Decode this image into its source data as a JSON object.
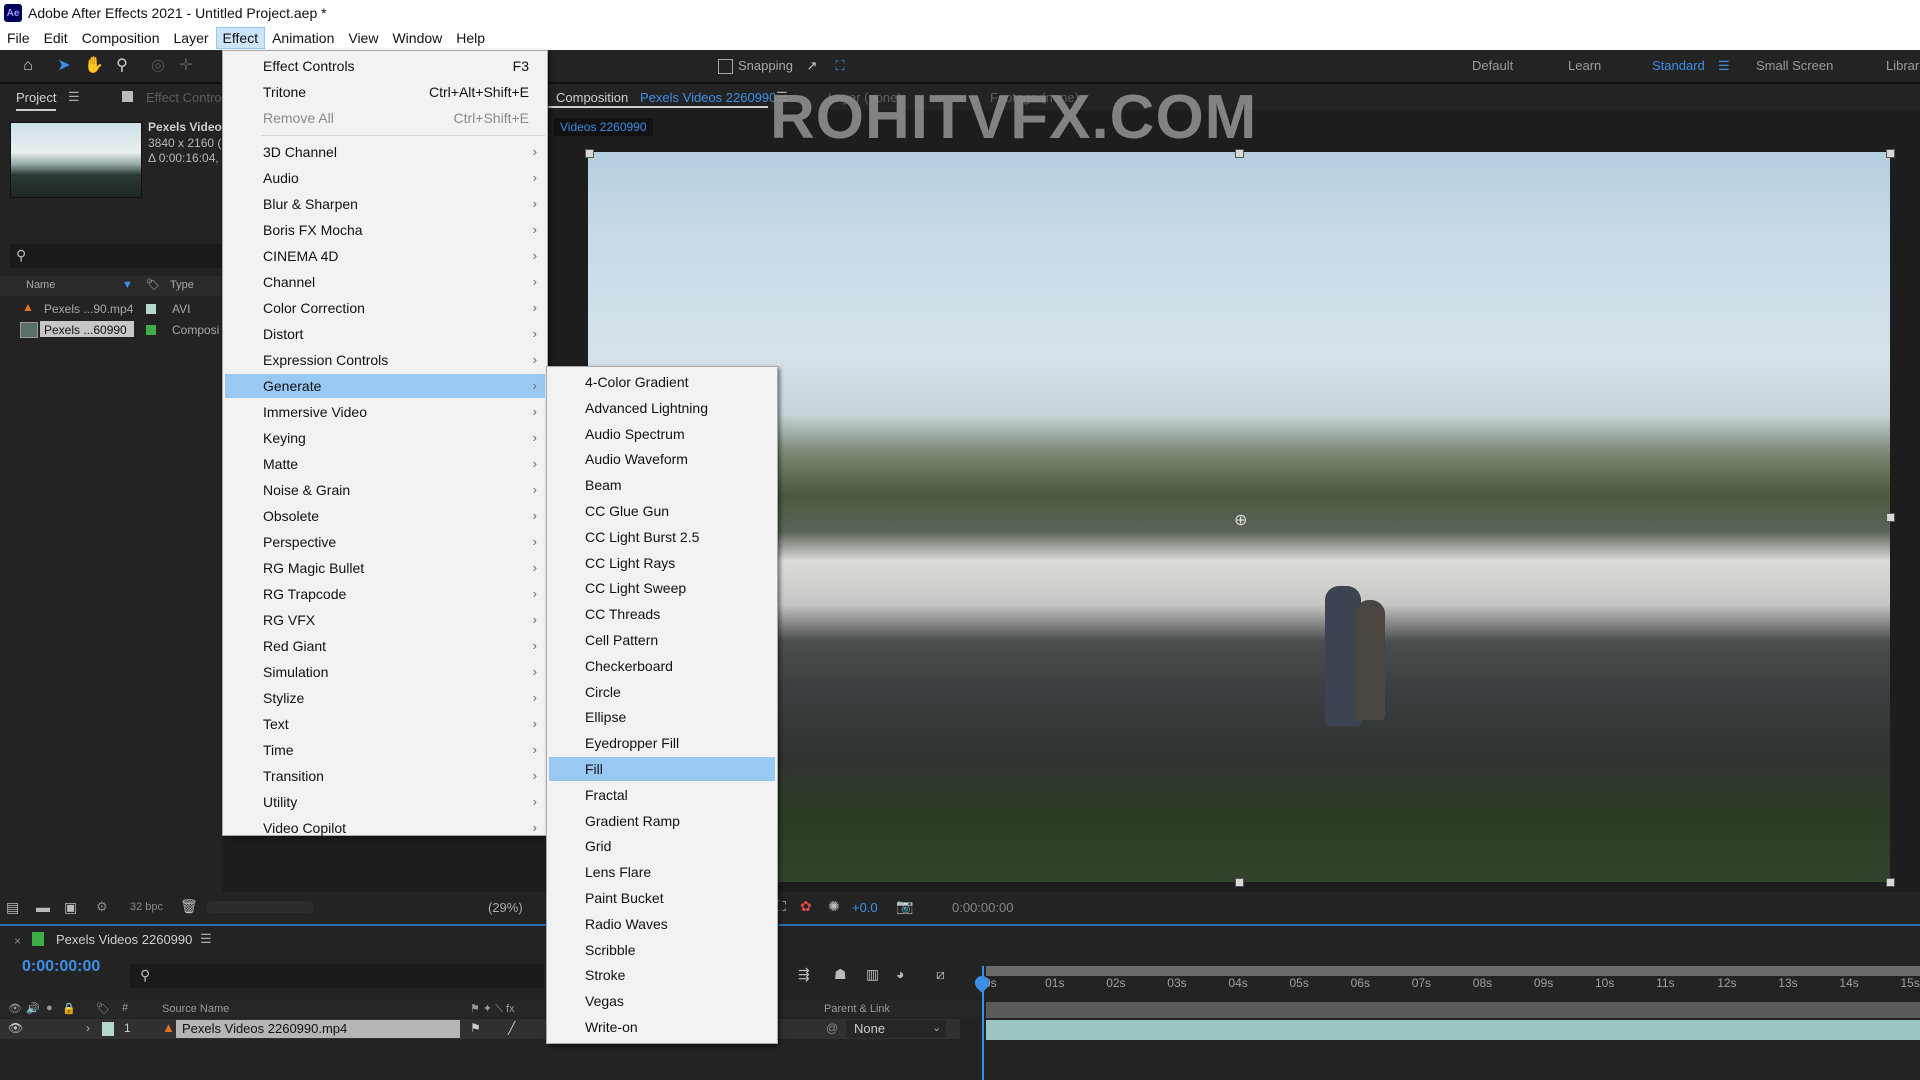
{
  "app": {
    "title": "Adobe After Effects 2021 - Untitled Project.aep *",
    "logo": "Ae"
  },
  "menubar": [
    "File",
    "Edit",
    "Composition",
    "Layer",
    "Effect",
    "Animation",
    "View",
    "Window",
    "Help"
  ],
  "toolbar": {
    "tools": [
      "home-icon",
      "selection-arrow-icon",
      "hand-icon",
      "zoom-icon",
      "orbit-camera-icon",
      "pan-behind-icon"
    ],
    "snapping_label": "Snapping",
    "workspaces": [
      "Default",
      "Learn",
      "Standard",
      "Small Screen",
      "Librar"
    ],
    "active_workspace": "Standard"
  },
  "project_panel": {
    "tab_project": "Project",
    "tab_effect_controls": "Effect Contro",
    "item_name": "Pexels Video",
    "item_resolution": "3840 x 2160 (",
    "item_duration": "Δ 0:00:16:04,",
    "columns": {
      "name": "Name",
      "type": "Type"
    },
    "rows": [
      {
        "name": "Pexels ...90.mp4",
        "type": "AVI",
        "label_color": "#b4d8cc"
      },
      {
        "name": "Pexels ...60990",
        "type": "Composi",
        "label_color": "#3fae49"
      }
    ],
    "bpc": "32 bpc"
  },
  "composition": {
    "tab_label": "Composition",
    "tab_name": "Pexels Videos 2260990",
    "layer_tab": "Layer (none)",
    "footage_tab": "Footage (none)",
    "sub_tab": "Videos 2260990",
    "zoom_level": "(29%)",
    "exposure": "+0.0",
    "timecode": "0:00:00:00"
  },
  "watermark": "ROHITVFX.COM",
  "effect_menu": {
    "items": [
      {
        "label": "Effect Controls",
        "shortcut": "F3"
      },
      {
        "label": "Tritone",
        "shortcut": "Ctrl+Alt+Shift+E"
      },
      {
        "label": "Remove All",
        "shortcut": "Ctrl+Shift+E",
        "disabled": true
      },
      {
        "label": "3D Channel",
        "submenu": true
      },
      {
        "label": "Audio",
        "submenu": true
      },
      {
        "label": "Blur & Sharpen",
        "submenu": true
      },
      {
        "label": "Boris FX Mocha",
        "submenu": true
      },
      {
        "label": "CINEMA 4D",
        "submenu": true
      },
      {
        "label": "Channel",
        "submenu": true
      },
      {
        "label": "Color Correction",
        "submenu": true
      },
      {
        "label": "Distort",
        "submenu": true
      },
      {
        "label": "Expression Controls",
        "submenu": true
      },
      {
        "label": "Generate",
        "submenu": true,
        "highlighted": true
      },
      {
        "label": "Immersive Video",
        "submenu": true
      },
      {
        "label": "Keying",
        "submenu": true
      },
      {
        "label": "Matte",
        "submenu": true
      },
      {
        "label": "Noise & Grain",
        "submenu": true
      },
      {
        "label": "Obsolete",
        "submenu": true
      },
      {
        "label": "Perspective",
        "submenu": true
      },
      {
        "label": "RG Magic Bullet",
        "submenu": true
      },
      {
        "label": "RG Trapcode",
        "submenu": true
      },
      {
        "label": "RG VFX",
        "submenu": true
      },
      {
        "label": "Red Giant",
        "submenu": true
      },
      {
        "label": "Simulation",
        "submenu": true
      },
      {
        "label": "Stylize",
        "submenu": true
      },
      {
        "label": "Text",
        "submenu": true
      },
      {
        "label": "Time",
        "submenu": true
      },
      {
        "label": "Transition",
        "submenu": true
      },
      {
        "label": "Utility",
        "submenu": true
      },
      {
        "label": "Video Copilot",
        "submenu": true
      }
    ]
  },
  "generate_submenu": {
    "items": [
      "4-Color Gradient",
      "Advanced Lightning",
      "Audio Spectrum",
      "Audio Waveform",
      "Beam",
      "CC Glue Gun",
      "CC Light Burst 2.5",
      "CC Light Rays",
      "CC Light Sweep",
      "CC Threads",
      "Cell Pattern",
      "Checkerboard",
      "Circle",
      "Ellipse",
      "Eyedropper Fill",
      "Fill",
      "Fractal",
      "Gradient Ramp",
      "Grid",
      "Lens Flare",
      "Paint Bucket",
      "Radio Waves",
      "Scribble",
      "Stroke",
      "Vegas",
      "Write-on"
    ],
    "highlighted": "Fill"
  },
  "timeline": {
    "comp_name": "Pexels Videos 2260990",
    "current_time": "0:00:00:00",
    "columns": {
      "source_name": "Source Name",
      "parent": "Parent & Link"
    },
    "layer": {
      "index": "1",
      "name": "Pexels Videos 2260990.mp4",
      "parent": "None"
    },
    "ruler_ticks": [
      "0s",
      "01s",
      "02s",
      "03s",
      "04s",
      "05s",
      "06s",
      "07s",
      "08s",
      "09s",
      "10s",
      "11s",
      "12s",
      "13s",
      "14s",
      "15s"
    ]
  },
  "colors": {
    "accent": "#3d8ee6",
    "menu_highlight": "#99c9f3",
    "panel_bg": "#232323",
    "layer_bar": "#9cc6c0"
  }
}
